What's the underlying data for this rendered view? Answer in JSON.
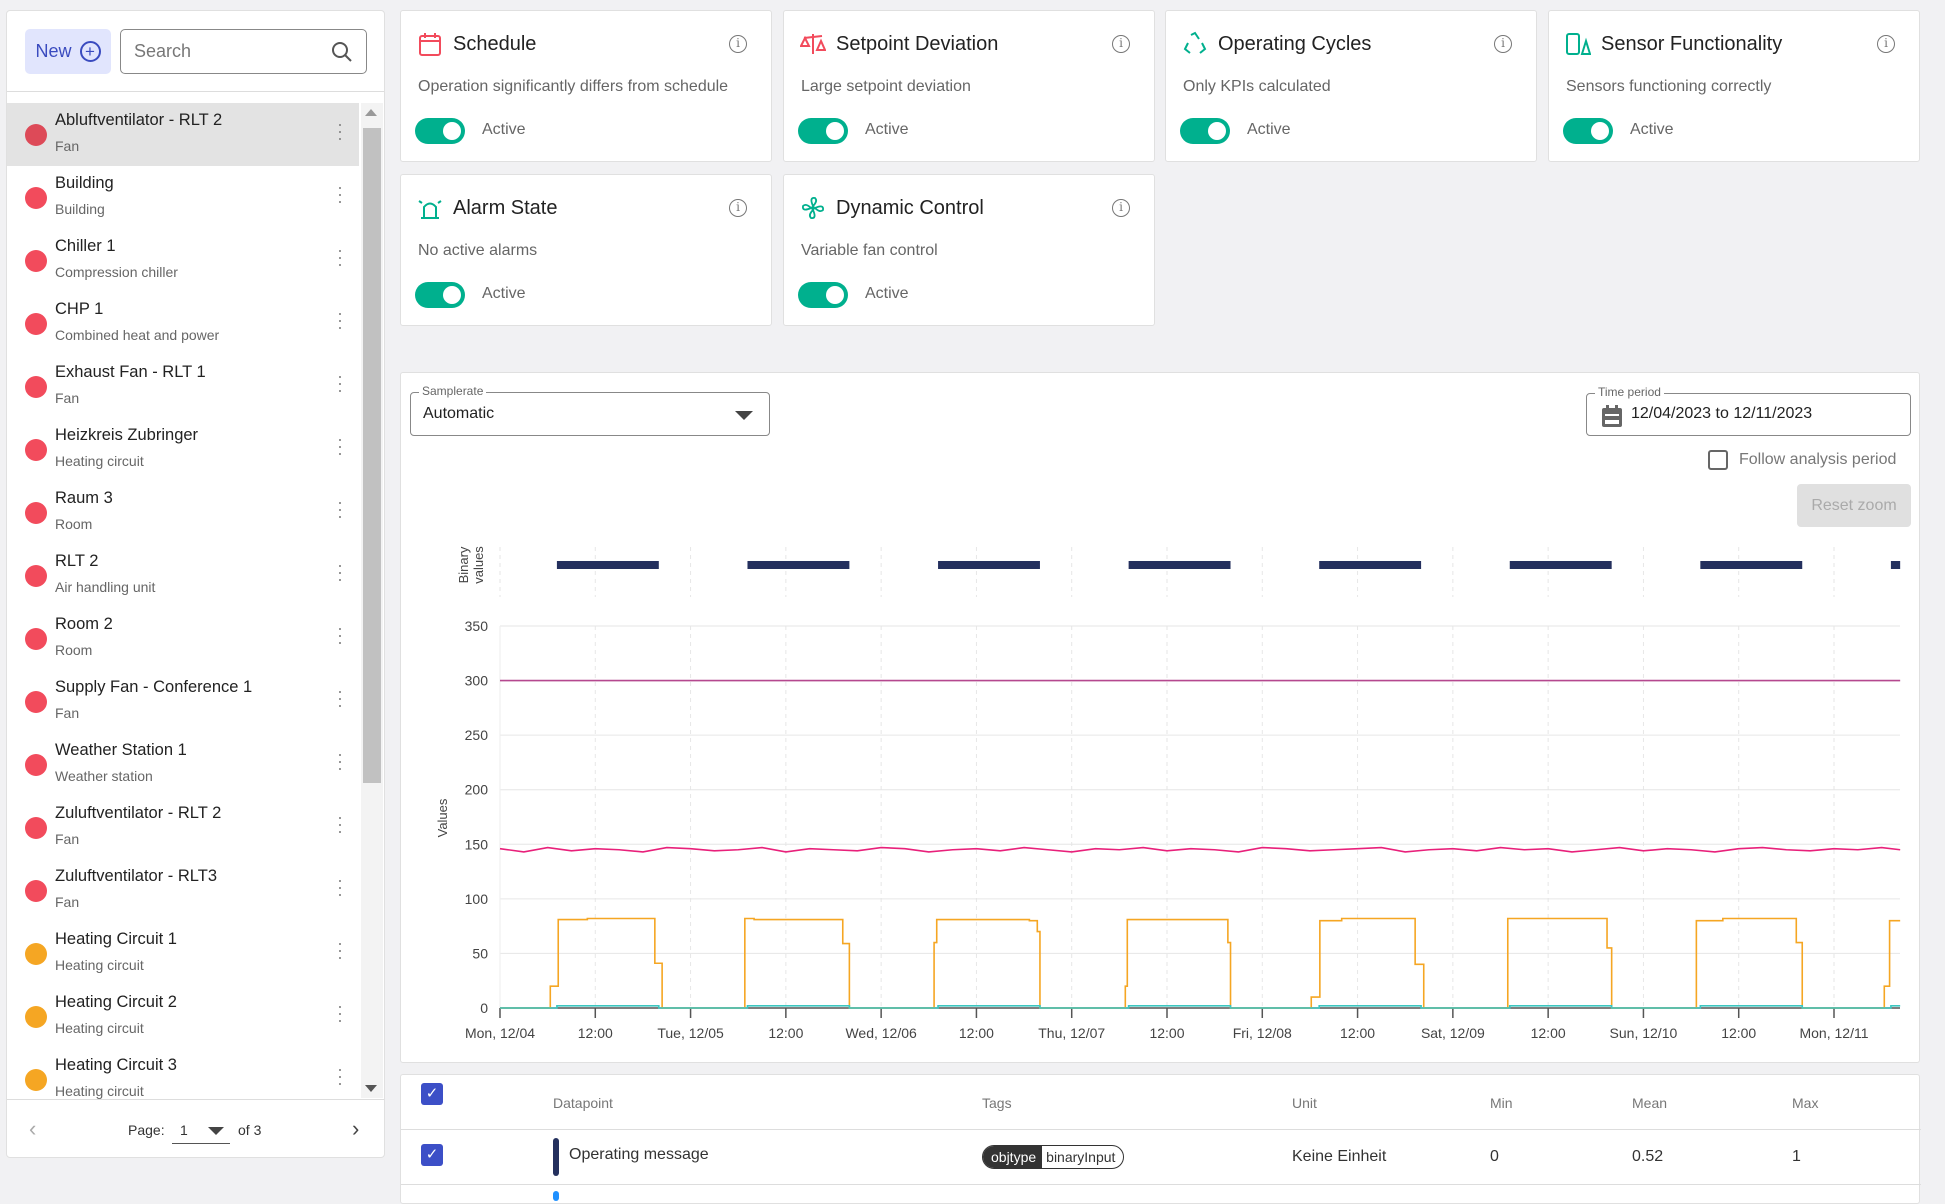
{
  "sidebar": {
    "new_label": "New",
    "search_placeholder": "Search",
    "items": [
      {
        "name": "Abluftventilator - RLT 2",
        "type": "Fan",
        "status": "red",
        "selected": true
      },
      {
        "name": "Building",
        "type": "Building",
        "status": "red"
      },
      {
        "name": "Chiller 1",
        "type": "Compression chiller",
        "status": "red"
      },
      {
        "name": "CHP 1",
        "type": "Combined heat and power",
        "status": "red"
      },
      {
        "name": "Exhaust Fan - RLT 1",
        "type": "Fan",
        "status": "red"
      },
      {
        "name": "Heizkreis Zubringer",
        "type": "Heating circuit",
        "status": "red"
      },
      {
        "name": "Raum 3",
        "type": "Room",
        "status": "red"
      },
      {
        "name": "RLT 2",
        "type": "Air handling unit",
        "status": "red"
      },
      {
        "name": "Room 2",
        "type": "Room",
        "status": "red"
      },
      {
        "name": "Supply Fan - Conference 1",
        "type": "Fan",
        "status": "red"
      },
      {
        "name": "Weather Station 1",
        "type": "Weather station",
        "status": "red"
      },
      {
        "name": "Zuluftventilator - RLT 2",
        "type": "Fan",
        "status": "red"
      },
      {
        "name": "Zuluftventilator - RLT3",
        "type": "Fan",
        "status": "red"
      },
      {
        "name": "Heating Circuit 1",
        "type": "Heating circuit",
        "status": "orange"
      },
      {
        "name": "Heating Circuit 2",
        "type": "Heating circuit",
        "status": "orange"
      },
      {
        "name": "Heating Circuit 3",
        "type": "Heating circuit",
        "status": "orange"
      }
    ],
    "pager": {
      "label": "Page:",
      "page": "1",
      "of": "of 3"
    }
  },
  "colors": {
    "red": "#f24b5c",
    "red_selected": "#dd4a58",
    "orange": "#f5a623",
    "toggle": "#00b08e",
    "accent": "#3c4fc7"
  },
  "cards": [
    {
      "title": "Schedule",
      "desc": "Operation significantly differs from schedule",
      "status": "Active",
      "icon": "calendar-icon",
      "color": "#f24b5c"
    },
    {
      "title": "Setpoint Deviation",
      "desc": "Large setpoint deviation",
      "status": "Active",
      "icon": "scale-icon",
      "color": "#f24b5c"
    },
    {
      "title": "Operating Cycles",
      "desc": "Only KPIs calculated",
      "status": "Active",
      "icon": "recycle-icon",
      "color": "#00b08e"
    },
    {
      "title": "Sensor Functionality",
      "desc": "Sensors functioning correctly",
      "status": "Active",
      "icon": "sensor-warning-icon",
      "color": "#00b08e"
    },
    {
      "title": "Alarm State",
      "desc": "No active alarms",
      "status": "Active",
      "icon": "alarm-light-icon",
      "color": "#00b08e"
    },
    {
      "title": "Dynamic Control",
      "desc": "Variable fan control",
      "status": "Active",
      "icon": "fan-icon",
      "color": "#00b08e"
    }
  ],
  "controls": {
    "samplerate_label": "Samplerate",
    "samplerate_value": "Automatic",
    "period_label": "Time period",
    "period_value": "12/04/2023 to 12/11/2023",
    "follow_label": "Follow analysis period",
    "reset_label": "Reset zoom"
  },
  "chart_data": {
    "type": "line",
    "ylabel": "Values",
    "binary_label": "Binary values",
    "ylim": [
      0,
      350
    ],
    "yticks": [
      0,
      50,
      100,
      150,
      200,
      250,
      300,
      350
    ],
    "xlim": [
      "12/04 00:00",
      "12/11 08:20"
    ],
    "xticks": [
      "Mon, 12/04",
      "12:00",
      "Tue, 12/05",
      "12:00",
      "Wed, 12/06",
      "12:00",
      "Thu, 12/07",
      "12:00",
      "Fri, 12/08",
      "12:00",
      "Sat, 12/09",
      "12:00",
      "Sun, 12/10",
      "12:00",
      "Mon, 12/11"
    ],
    "grid": true,
    "binary": {
      "color": "#24305e",
      "on_periods": [
        [
          "12/04 07:10",
          "12/04 20:00"
        ],
        [
          "12/05 07:10",
          "12/05 20:00"
        ],
        [
          "12/06 07:10",
          "12/06 20:00"
        ],
        [
          "12/07 07:10",
          "12/07 20:00"
        ],
        [
          "12/08 07:10",
          "12/08 20:00"
        ],
        [
          "12/09 07:10",
          "12/09 20:00"
        ],
        [
          "12/10 07:10",
          "12/10 20:00"
        ],
        [
          "12/11 07:10",
          "12/11 08:20"
        ]
      ]
    },
    "series": [
      {
        "color": "#b5488f",
        "points": [
          [
            "12/04 00:00",
            300
          ],
          [
            "12/11 08:20",
            300
          ]
        ]
      },
      {
        "color": "#e8207a",
        "start": "12/04 00:00",
        "interval_hours": 3,
        "values": [
          146,
          143,
          147,
          144,
          146,
          145,
          143,
          147,
          146,
          144,
          145,
          147,
          143,
          146,
          145,
          144,
          147,
          146,
          143,
          145,
          146,
          144,
          147,
          145,
          143,
          146,
          145,
          147,
          144,
          146,
          145,
          143,
          147,
          146,
          144,
          145,
          146,
          147,
          143,
          145,
          146,
          144,
          147,
          145,
          146,
          143,
          145,
          147,
          144,
          146,
          145,
          143,
          146,
          147,
          145,
          144,
          146,
          145,
          147,
          145
        ]
      },
      {
        "color": "#f5a623",
        "step": true,
        "points": [
          [
            "12/04 00:00",
            0
          ],
          [
            "12/04 06:20",
            20
          ],
          [
            "12/04 07:20",
            81
          ],
          [
            "12/04 11:00",
            82
          ],
          [
            "12/04 19:30",
            41
          ],
          [
            "12/04 20:25",
            0
          ],
          [
            "12/05 06:50",
            82
          ],
          [
            "12/05 08:00",
            81
          ],
          [
            "12/05 19:10",
            59
          ],
          [
            "12/05 20:00",
            0
          ],
          [
            "12/06 06:40",
            60
          ],
          [
            "12/06 07:00",
            81
          ],
          [
            "12/06 18:40",
            80
          ],
          [
            "12/06 19:40",
            70
          ],
          [
            "12/06 20:00",
            0
          ],
          [
            "12/07 06:45",
            20
          ],
          [
            "12/07 07:00",
            81
          ],
          [
            "12/07 19:40",
            60
          ],
          [
            "12/07 20:00",
            0
          ],
          [
            "12/08 06:10",
            10
          ],
          [
            "12/08 07:15",
            80
          ],
          [
            "12/08 10:00",
            82
          ],
          [
            "12/08 19:15",
            40
          ],
          [
            "12/08 20:20",
            0
          ],
          [
            "12/09 06:55",
            82
          ],
          [
            "12/09 19:25",
            55
          ],
          [
            "12/09 20:00",
            0
          ],
          [
            "12/10 06:40",
            80
          ],
          [
            "12/10 10:00",
            82
          ],
          [
            "12/10 19:15",
            60
          ],
          [
            "12/10 20:00",
            0
          ],
          [
            "12/11 06:20",
            20
          ],
          [
            "12/11 07:00",
            80
          ],
          [
            "12/11 08:20",
            80
          ]
        ]
      },
      {
        "color": "#3cc6c0",
        "step": true,
        "points": [
          [
            "12/04 00:00",
            0
          ],
          [
            "12/04 07:10",
            2
          ],
          [
            "12/04 20:00",
            0
          ],
          [
            "12/05 07:10",
            2
          ],
          [
            "12/05 20:00",
            0
          ],
          [
            "12/06 07:10",
            2
          ],
          [
            "12/06 20:00",
            0
          ],
          [
            "12/07 07:10",
            2
          ],
          [
            "12/07 20:00",
            0
          ],
          [
            "12/08 07:10",
            2
          ],
          [
            "12/08 20:00",
            0
          ],
          [
            "12/09 07:10",
            2
          ],
          [
            "12/09 20:00",
            0
          ],
          [
            "12/10 07:10",
            2
          ],
          [
            "12/10 20:00",
            0
          ],
          [
            "12/11 07:10",
            2
          ],
          [
            "12/11 08:20",
            2
          ]
        ]
      }
    ]
  },
  "table": {
    "headers": {
      "datapoint": "Datapoint",
      "tags": "Tags",
      "unit": "Unit",
      "min": "Min",
      "mean": "Mean",
      "max": "Max"
    },
    "rows": [
      {
        "datapoint": "Operating message",
        "color": "#24305e",
        "tag_key": "objtype",
        "tag_value": "binaryInput",
        "unit": "Keine Einheit",
        "min": "0",
        "mean": "0.52",
        "max": "1"
      }
    ]
  }
}
